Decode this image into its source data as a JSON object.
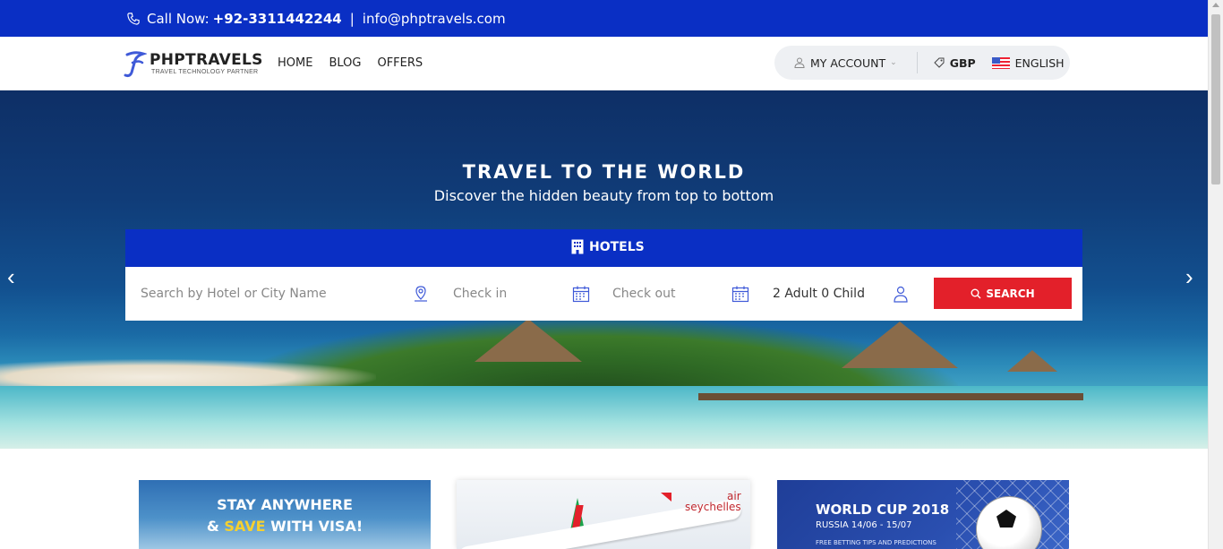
{
  "topbar": {
    "call_label": "Call Now:",
    "phone": "+92-3311442244",
    "separator": "|",
    "email": "info@phptravels.com"
  },
  "logo": {
    "brand": "PHPTRAVELS",
    "tagline": "TRAVEL TECHNOLOGY PARTNER"
  },
  "nav": {
    "items": [
      {
        "label": "HOME"
      },
      {
        "label": "BLOG"
      },
      {
        "label": "OFFERS"
      }
    ]
  },
  "account": {
    "my_account": "MY ACCOUNT",
    "currency": "GBP",
    "language": "ENGLISH"
  },
  "hero": {
    "title": "TRAVEL TO THE WORLD",
    "subtitle": "Discover the hidden beauty from top to bottom",
    "prev_arrow": "‹",
    "next_arrow": "›"
  },
  "search": {
    "tab_label": "HOTELS",
    "hotel_placeholder": "Search by Hotel or City Name",
    "checkin_placeholder": "Check in",
    "checkout_placeholder": "Check out",
    "guests": "2 Adult 0 Child",
    "button_label": "SEARCH"
  },
  "promos": {
    "visa": {
      "line1": "STAY ANYWHERE",
      "line2_prefix": "& ",
      "line2_highlight": "SAVE",
      "line2_suffix": " WITH VISA!"
    },
    "air": {
      "brand_top": "air",
      "brand_bottom": "seychelles"
    },
    "worldcup": {
      "title": "WORLD CUP 2018",
      "subtitle": "RUSSIA 14/06 - 15/07",
      "note": "FREE BETTING TIPS AND PREDICTIONS"
    }
  },
  "colors": {
    "primary_blue": "#0a2fc4",
    "search_red": "#e3202a",
    "icon_blue": "#3f5ad8"
  },
  "icons": {
    "phone": "phone-icon",
    "user": "user-icon",
    "currency": "tag-icon",
    "flag": "us-flag-icon",
    "hotel": "building-icon",
    "location": "map-pin-icon",
    "calendar": "calendar-icon",
    "guests": "user-icon",
    "search": "search-icon"
  }
}
